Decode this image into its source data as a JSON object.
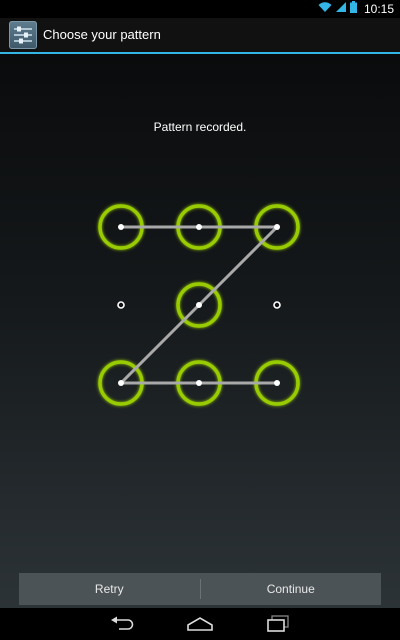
{
  "status_bar": {
    "time": "10:15"
  },
  "action_bar": {
    "title": "Choose your pattern",
    "app_icon": "settings-sliders-icon"
  },
  "pattern": {
    "message": "Pattern recorded.",
    "rows": 3,
    "cols": 3,
    "selected_dots": [
      1,
      2,
      3,
      5,
      7,
      8,
      9
    ],
    "path_sequence": [
      1,
      2,
      3,
      5,
      7,
      8,
      9
    ],
    "ring_color": "#99cc00",
    "line_color": "#a9a9a9",
    "dot_color": "#ffffff"
  },
  "buttons": {
    "retry": "Retry",
    "continue": "Continue"
  },
  "nav": {
    "back": "back-icon",
    "home": "home-icon",
    "recents": "recents-icon"
  }
}
